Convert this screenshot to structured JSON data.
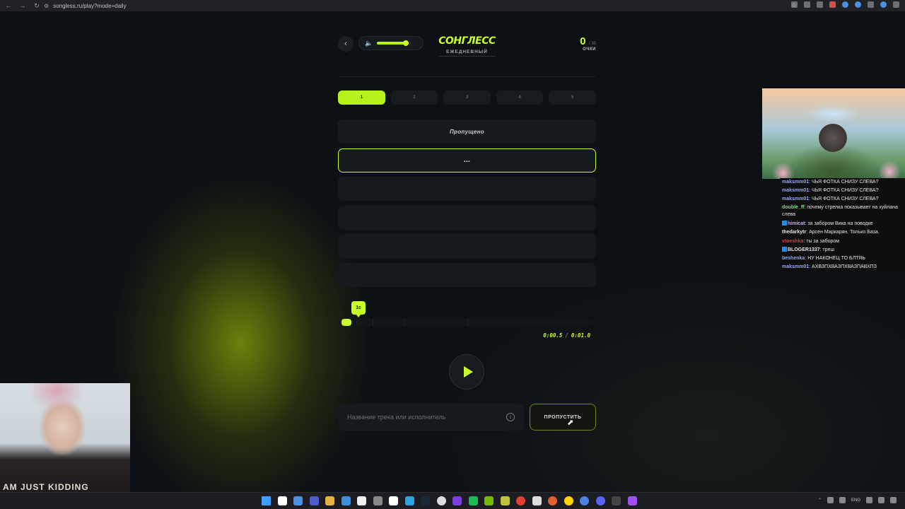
{
  "browser": {
    "url": "songless.ru/play?mode=daily",
    "icons": [
      "back-icon",
      "forward-icon",
      "reload-icon",
      "site-settings-icon",
      "bookmark-star-icon"
    ]
  },
  "game": {
    "title": "СОНГЛЕСС",
    "mode": "ЕЖЕДНЕВНЫЙ",
    "score": "0",
    "score_max": "/ 30",
    "score_label": "ОЧКИ",
    "volume_level": 0.85,
    "steps": [
      "1",
      "2",
      "3",
      "4",
      "5"
    ],
    "active_step": 1,
    "guesses": [
      "Пропущено",
      "...",
      "",
      "",
      "",
      ""
    ],
    "clip_label": "1с",
    "progress_fraction": 0.04,
    "time_current": "0:00.5",
    "time_total": "0:01.0",
    "input_placeholder": "Название трека или исполнитель",
    "skip_label": "ПРОПУСТИТЬ",
    "accent_color": "#c8ff2a"
  },
  "chat": [
    {
      "user": "maksmm01",
      "color": "#8aa8ff",
      "text": "ЧЬЯ ФОТКА СНИЗУ СЛЕВА?"
    },
    {
      "user": "maksmm01",
      "color": "#8aa8ff",
      "text": "ЧЬЯ ФОТКА СНИЗУ СЛЕВА?"
    },
    {
      "user": "maksmm01",
      "color": "#8aa8ff",
      "text": "ЧЬЯ ФОТКА СНИЗУ СЛЕВА?"
    },
    {
      "user": "double_ff",
      "color": "#7fe07f",
      "text": "почему стрелка показывает на хуйлана слева"
    },
    {
      "user": "himicat",
      "color": "#c9a8ff",
      "text": "за забором Вика на поводке"
    },
    {
      "user": "thedarkytr",
      "color": "#e6e6e6",
      "text": "Арсен Маркарян. Только База."
    },
    {
      "user": "vtoeshka",
      "color": "#ff3030",
      "text": "ты за забором"
    },
    {
      "user": "BLOGER1337",
      "color": "#e6e6e6",
      "text": "треш"
    },
    {
      "user": "beshenka",
      "color": "#8aa8ff",
      "text": "НУ НАКОНЕЦ ТО БЛТЯЬ"
    },
    {
      "user": "maksmm01",
      "color": "#8aa8ff",
      "text": "АХВЗПХВАЗПХВАЗПАВХПЗ"
    }
  ],
  "webcam": {
    "shirt_text": "AM JUST KIDDING"
  },
  "taskbar": {
    "tray_lang": "ENG",
    "apps": [
      "windows-start",
      "search",
      "explorer",
      "terminal",
      "folder",
      "mail",
      "music",
      "notes",
      "calendar",
      "telegram",
      "steam",
      "chatgpt",
      "obs",
      "spotify",
      "nvidia",
      "game",
      "chrome",
      "epic",
      "brave",
      "yandex",
      "browser",
      "discord",
      "notion",
      "app"
    ],
    "app_colors": [
      "#3fa0ff",
      "#ffffff",
      "#4a90e2",
      "#4d5cc8",
      "#e2b340",
      "#3f8fe0",
      "#f0f0f0",
      "#888888",
      "#ffffff",
      "#2aa3df",
      "#1b2838",
      "#dddddd",
      "#7a3fd8",
      "#1db954",
      "#76b900",
      "#c0c040",
      "#e04030",
      "#dddddd",
      "#e06030",
      "#ffd400",
      "#5080e0",
      "#5865f2",
      "#444444",
      "#a050f0"
    ]
  }
}
